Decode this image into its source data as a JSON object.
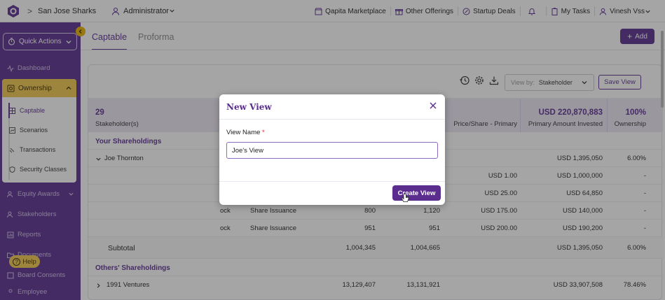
{
  "topbar": {
    "company": "San Jose Sharks",
    "role": "Administrator",
    "links": [
      "Qapita Marketplace",
      "Other Offerings",
      "Startup Deals"
    ],
    "my_tasks": "My Tasks",
    "user": "Vinesh Vss"
  },
  "sidebar": {
    "quick_actions": "Quick Actions",
    "dashboard": "Dashboard",
    "ownership": "Ownership",
    "sub_items": [
      "Captable",
      "Scenarios",
      "Transactions",
      "Security Classes"
    ],
    "equity_awards": "Equity Awards",
    "stakeholders": "Stakeholders",
    "reports": "Reports",
    "documents": "Documents",
    "board_consents": "Board Consents",
    "employee": "Employee",
    "help": "Help"
  },
  "main": {
    "tabs": [
      "Captable",
      "Proforma"
    ],
    "add_button": "Add",
    "view_by_label": "View by:",
    "view_by_value": "Stakeholder",
    "save_view": "Save View",
    "header": {
      "count": "29",
      "count_label": "Stakeholder(s)",
      "price_share_label": "Price/Share - Primary",
      "primary_invested_value": "USD 220,870,883",
      "primary_invested_label": "Primary Amount Invested",
      "ownership_value": "100%",
      "ownership_label": "Ownership"
    },
    "your_shareholdings": "Your Shareholdings",
    "holder": "Joe Thornton",
    "holder_invested": "USD 1,395,050",
    "holder_ownership": "6.00%",
    "rows": [
      {
        "security": "",
        "type": "",
        "col_a": "",
        "col_b": "",
        "price": "USD 1.00",
        "invested": "USD 1,000,000",
        "ownership": "-"
      },
      {
        "security": "",
        "type": "",
        "col_a": "",
        "col_b": "",
        "price": "USD 25.00",
        "invested": "USD 64,850",
        "ownership": "-"
      },
      {
        "security": "ock",
        "type": "Share Issuance",
        "col_a": "800",
        "col_b": "1,120",
        "price": "USD 175.00",
        "invested": "USD 140,000",
        "ownership": "-"
      },
      {
        "security": "ock",
        "type": "Share Issuance",
        "col_a": "951",
        "col_b": "951",
        "price": "USD 200.00",
        "invested": "USD 190,200",
        "ownership": "-"
      }
    ],
    "subtotal": {
      "label": "Subtotal",
      "col_a": "1,004,345",
      "col_b": "1,004,665",
      "invested": "USD 1,395,050",
      "ownership": "6.00%"
    },
    "others_shareholdings": "Others' Shareholdings",
    "other_holder": {
      "name": "1991 Ventures",
      "col_a": "13,129,407",
      "col_b": "13,131,921",
      "invested": "USD 33,907,508",
      "ownership": "78.46%"
    }
  },
  "modal": {
    "title": "New View",
    "field_label": "View Name",
    "required_mark": "*",
    "field_value": "Joe's View",
    "create_button": "Create View"
  }
}
